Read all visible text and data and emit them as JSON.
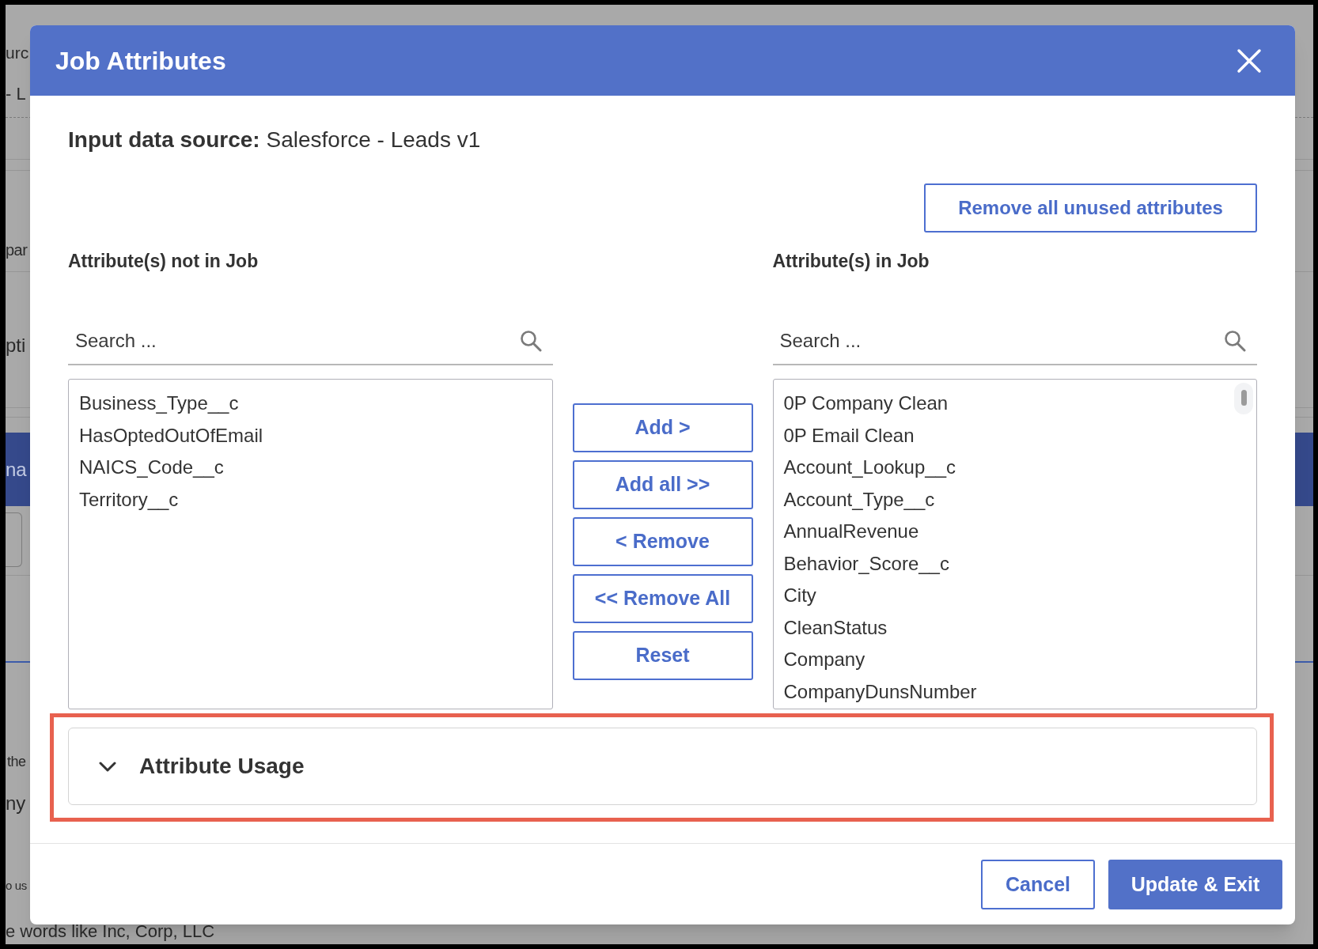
{
  "background": {
    "texts": [
      "urc",
      "- L",
      "par",
      "pti",
      "na",
      "the",
      "ny",
      "o us",
      "e words like Inc, Corp, LLC"
    ]
  },
  "dialog": {
    "title": "Job Attributes"
  },
  "source": "**Input data source:** Salesforce - Leads v1",
  "remove_unused_button": "Remove all unused attributes",
  "available": {
    "heading": "Attribute(s) not in Job",
    "search": {
      "placeholder": "Search ..."
    },
    "items": [
      {
        "label": "Business_Type__c",
        "selected": false
      },
      {
        "label": "HasOptedOutOfEmail",
        "selected": false
      },
      {
        "label": "NAICS_Code__c",
        "selected": false
      },
      {
        "label": "Territory__c",
        "selected": false
      }
    ]
  },
  "transfer_buttons": [
    "Add >",
    "Add all >>",
    "< Remove",
    "<< Remove All",
    "Reset"
  ],
  "in_job": {
    "heading": "Attribute(s) in Job",
    "search": {
      "placeholder": "Search ..."
    },
    "items": [
      {
        "label": "0P Company Clean",
        "selected": false
      },
      {
        "label": "0P Email Clean",
        "selected": false
      },
      {
        "label": "Account_Lookup__c",
        "selected": false
      },
      {
        "label": "Account_Type__c",
        "selected": false
      },
      {
        "label": "AnnualRevenue",
        "selected": false
      },
      {
        "label": "Behavior_Score__c",
        "selected": false
      },
      {
        "label": "City",
        "selected": false
      },
      {
        "label": "CleanStatus",
        "selected": false
      },
      {
        "label": "Company",
        "selected": false
      },
      {
        "label": "CompanyDunsNumber",
        "selected": false
      }
    ]
  },
  "attribute_usage": {
    "title": "Attribute Usage",
    "expanded": false,
    "highlighted": true
  },
  "footer": {
    "buttons": [
      {
        "label": "Cancel",
        "kind": "secondary"
      },
      {
        "label": "Update & Exit",
        "kind": "primary"
      }
    ]
  }
}
